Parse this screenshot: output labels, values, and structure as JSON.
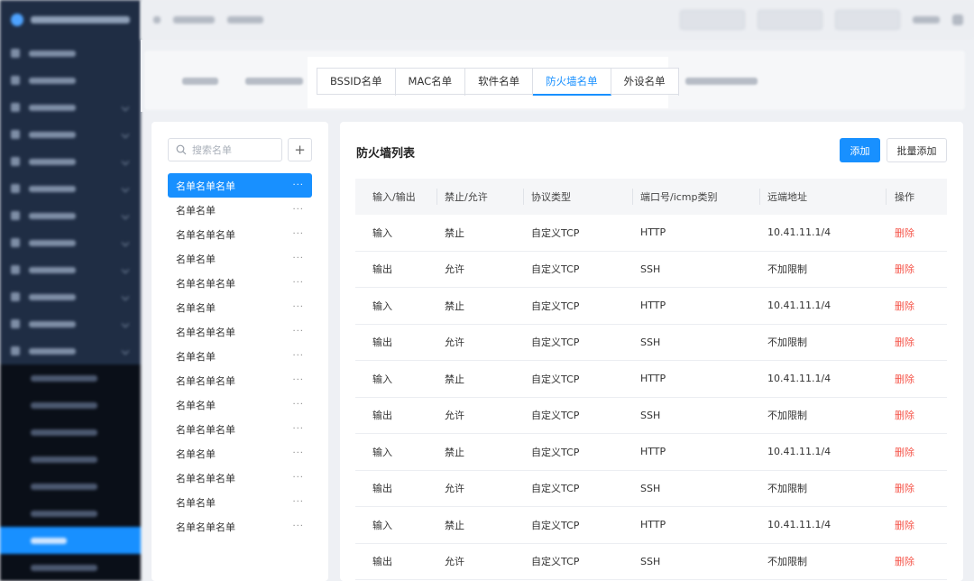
{
  "tabs": [
    {
      "label": "BSSID名单",
      "active": false
    },
    {
      "label": "MAC名单",
      "active": false
    },
    {
      "label": "软件名单",
      "active": false
    },
    {
      "label": "防火墙名单",
      "active": true
    },
    {
      "label": "外设名单",
      "active": false
    }
  ],
  "left": {
    "search_placeholder": "搜索名单",
    "add_symbol": "+",
    "more_symbol": "···",
    "items": [
      {
        "label": "名单名单名单",
        "active": true
      },
      {
        "label": "名单名单",
        "active": false
      },
      {
        "label": "名单名单名单",
        "active": false
      },
      {
        "label": "名单名单",
        "active": false
      },
      {
        "label": "名单名单名单",
        "active": false
      },
      {
        "label": "名单名单",
        "active": false
      },
      {
        "label": "名单名单名单",
        "active": false
      },
      {
        "label": "名单名单",
        "active": false
      },
      {
        "label": "名单名单名单",
        "active": false
      },
      {
        "label": "名单名单",
        "active": false
      },
      {
        "label": "名单名单名单",
        "active": false
      },
      {
        "label": "名单名单",
        "active": false
      },
      {
        "label": "名单名单名单",
        "active": false
      },
      {
        "label": "名单名单",
        "active": false
      },
      {
        "label": "名单名单名单",
        "active": false
      }
    ]
  },
  "main": {
    "title": "防火墙列表",
    "add_label": "添加",
    "batch_add_label": "批量添加",
    "columns": [
      "输入/输出",
      "禁止/允许",
      "协议类型",
      "端口号/icmp类别",
      "远端地址",
      "操作"
    ],
    "rows": [
      [
        "输入",
        "禁止",
        "自定义TCP",
        "HTTP",
        "10.41.11.1/4",
        "删除"
      ],
      [
        "输出",
        "允许",
        "自定义TCP",
        "SSH",
        "不加限制",
        "删除"
      ],
      [
        "输入",
        "禁止",
        "自定义TCP",
        "HTTP",
        "10.41.11.1/4",
        "删除"
      ],
      [
        "输出",
        "允许",
        "自定义TCP",
        "SSH",
        "不加限制",
        "删除"
      ],
      [
        "输入",
        "禁止",
        "自定义TCP",
        "HTTP",
        "10.41.11.1/4",
        "删除"
      ],
      [
        "输出",
        "允许",
        "自定义TCP",
        "SSH",
        "不加限制",
        "删除"
      ],
      [
        "输入",
        "禁止",
        "自定义TCP",
        "HTTP",
        "10.41.11.1/4",
        "删除"
      ],
      [
        "输出",
        "允许",
        "自定义TCP",
        "SSH",
        "不加限制",
        "删除"
      ],
      [
        "输入",
        "禁止",
        "自定义TCP",
        "HTTP",
        "10.41.11.1/4",
        "删除"
      ],
      [
        "输出",
        "允许",
        "自定义TCP",
        "SSH",
        "不加限制",
        "删除"
      ]
    ]
  },
  "colors": {
    "accent": "#1890ff",
    "danger": "#f5554a",
    "sidebar": "#1f2d44"
  }
}
